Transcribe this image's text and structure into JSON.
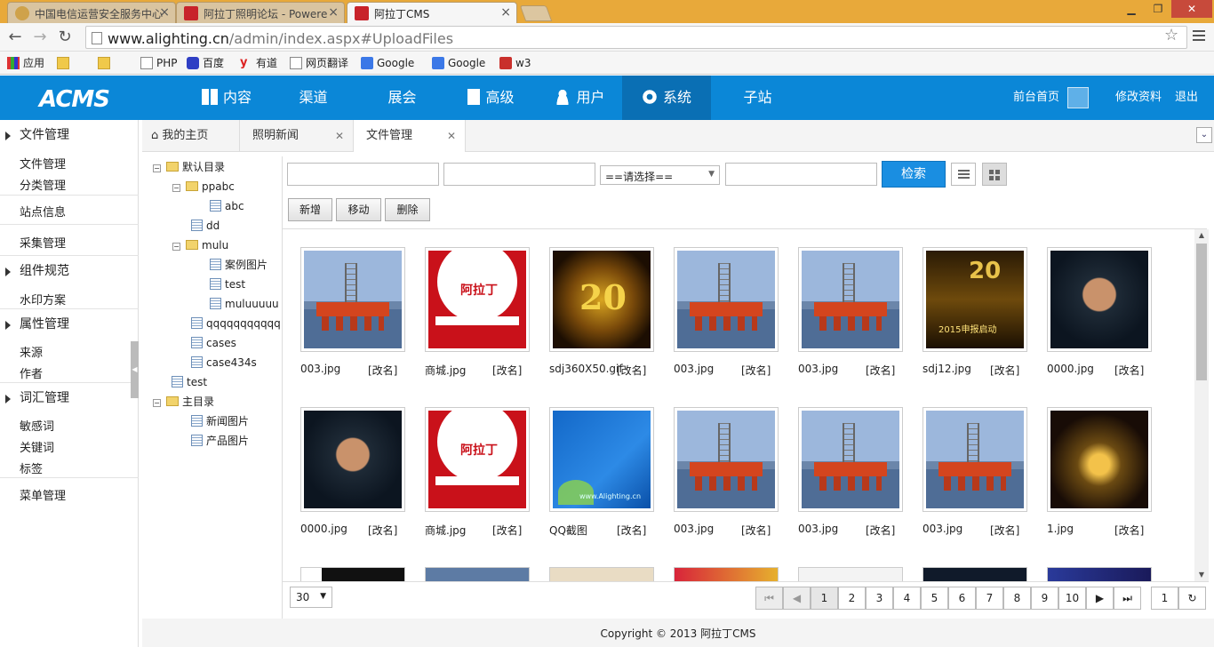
{
  "browser": {
    "tabs": [
      {
        "title": "中国电信运营安全服务中心"
      },
      {
        "title": "阿拉丁照明论坛 - Powere"
      },
      {
        "title": "阿拉丁CMS"
      }
    ],
    "url_host": "www.alighting.cn",
    "url_path": "/admin/index.aspx#UploadFiles",
    "bookmarks": [
      "应用",
      "",
      "",
      "PHP",
      "百度",
      "有道",
      "网页翻译",
      "Google",
      "Google",
      "w3"
    ]
  },
  "header": {
    "logo": "ACMS",
    "nav": [
      "内容",
      "渠道",
      "展会",
      "高级",
      "用户",
      "系统",
      "子站"
    ],
    "right": {
      "home": "前台首页",
      "profile": "修改资料",
      "logout": "退出"
    }
  },
  "sidebar": {
    "groups": [
      {
        "label": "文件管理",
        "items": [
          "文件管理",
          "分类管理"
        ]
      },
      {
        "label": "站点信息"
      },
      {
        "label": "采集管理"
      },
      {
        "label": "组件规范",
        "items": [
          "水印方案"
        ]
      },
      {
        "label": "属性管理",
        "items": [
          "来源",
          "作者"
        ]
      },
      {
        "label": "词汇管理",
        "items": [
          "敏感词",
          "关键词",
          "标签"
        ]
      },
      {
        "label": "菜单管理"
      }
    ]
  },
  "worktabs": [
    "我的主页",
    "照明新闻",
    "文件管理"
  ],
  "tree": [
    "默认目录",
    "ppabc",
    "abc",
    "dd",
    "mulu",
    "案例图片",
    "test",
    "muluuuuu",
    "qqqqqqqqqqq",
    "cases",
    "case434s",
    "test",
    "主目录",
    "新闻图片",
    "产品图片"
  ],
  "toolbar": {
    "select_value": "==请选择==",
    "search_label": "检索",
    "add_label": "新增",
    "move_label": "移动",
    "delete_label": "删除"
  },
  "files": [
    {
      "name": "003.jpg",
      "action": "[改名]"
    },
    {
      "name": "商城.jpg",
      "action": "[改名]"
    },
    {
      "name": "sdj360X50.gif",
      "action": "[改名]"
    },
    {
      "name": "003.jpg",
      "action": "[改名]"
    },
    {
      "name": "003.jpg",
      "action": "[改名]"
    },
    {
      "name": "sdj12.jpg",
      "action": "[改名]"
    },
    {
      "name": "0000.jpg",
      "action": "[改名]"
    },
    {
      "name": "0000.jpg",
      "action": "[改名]"
    },
    {
      "name": "商城.jpg",
      "action": "[改名]"
    },
    {
      "name": "QQ截图",
      "action": "[改名]"
    },
    {
      "name": "003.jpg",
      "action": "[改名]"
    },
    {
      "name": "003.jpg",
      "action": "[改名]"
    },
    {
      "name": "003.jpg",
      "action": "[改名]"
    },
    {
      "name": "1.jpg",
      "action": "[改名]"
    }
  ],
  "image_overlays": {
    "gold_number": "20",
    "gold_caption": "2015申报启动",
    "shop_brand": "阿拉丁",
    "blue_watermark": "www.Alighting.cn"
  },
  "pager": {
    "page_size": "30",
    "pages": [
      "1",
      "2",
      "3",
      "4",
      "5",
      "6",
      "7",
      "8",
      "9",
      "10"
    ],
    "current": "1",
    "goto_value": "1"
  },
  "footer": "Copyright © 2013 阿拉丁CMS",
  "colors": {
    "header_bg": "#0b87d7",
    "header_active": "#0a6fb4",
    "search_btn": "#1a8ee1"
  }
}
